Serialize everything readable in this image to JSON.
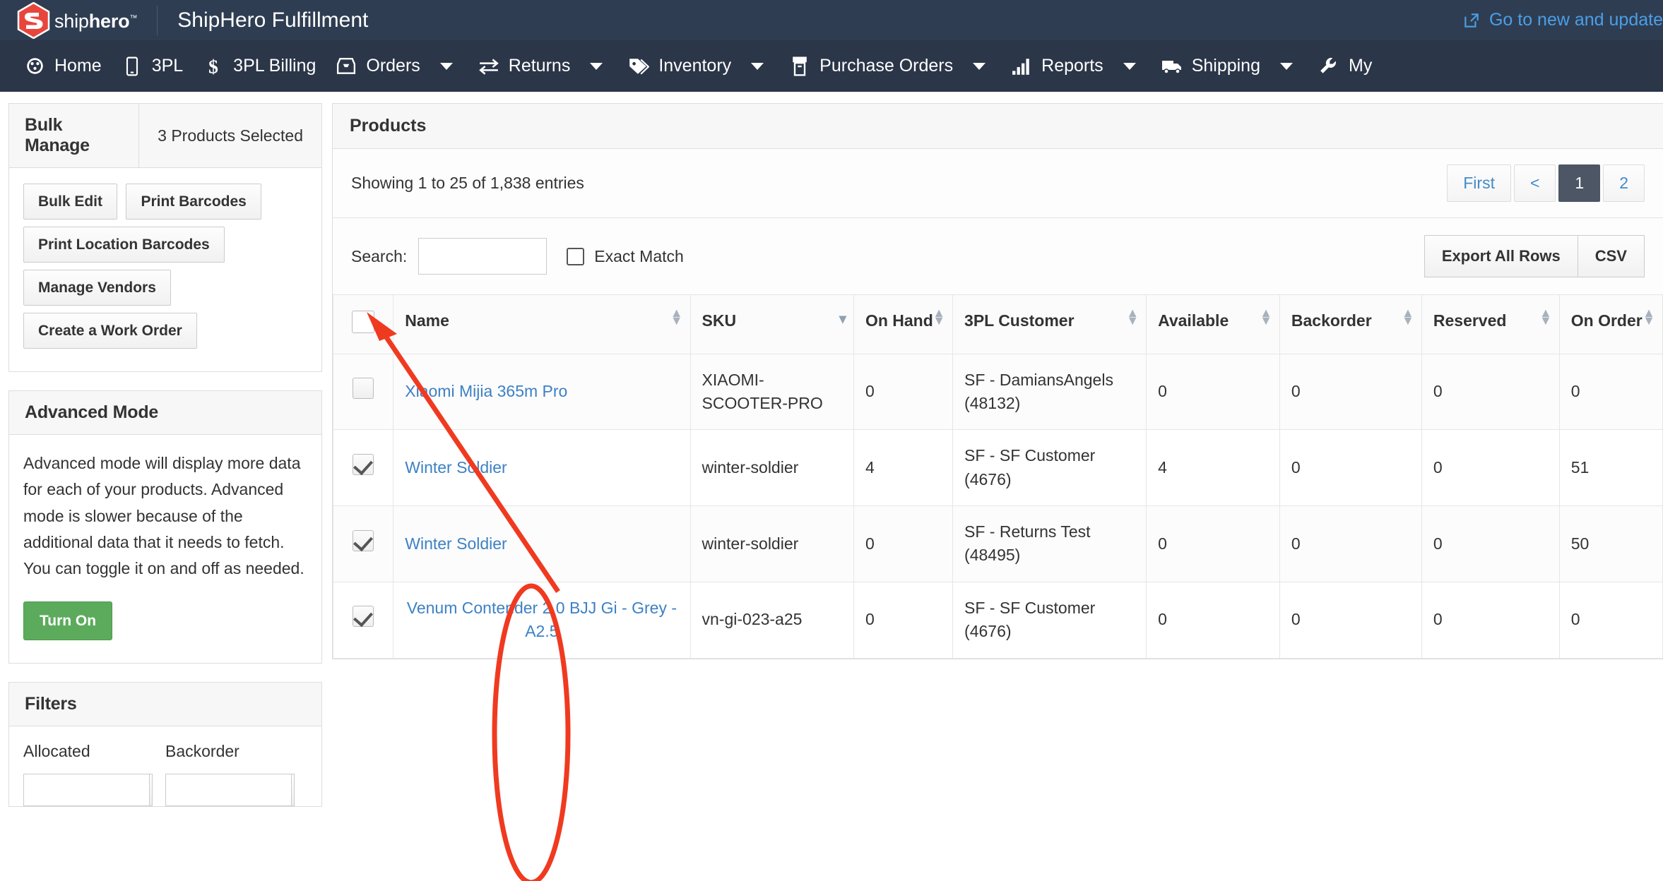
{
  "header": {
    "brand_name_light": "ship",
    "brand_name_bold": "hero",
    "brand_tm": "™",
    "app_title": "ShipHero Fulfillment",
    "new_link": "Go to new and update",
    "colors": {
      "topbar": "#2f3d52",
      "navbar": "#2b3648",
      "brand_red": "#e8463c",
      "link_blue": "#4a9fe8"
    }
  },
  "nav": {
    "items": [
      {
        "label": "Home",
        "icon": "dashboard-icon",
        "has_caret": false
      },
      {
        "label": "3PL",
        "icon": "mobile-icon",
        "has_caret": false
      },
      {
        "label": "3PL Billing",
        "icon": "dollar-icon",
        "has_caret": false
      },
      {
        "label": "Orders",
        "icon": "inbox-icon",
        "has_caret": true
      },
      {
        "label": "Returns",
        "icon": "exchange-icon",
        "has_caret": true
      },
      {
        "label": "Inventory",
        "icon": "tags-icon",
        "has_caret": true
      },
      {
        "label": "Purchase Orders",
        "icon": "archive-icon",
        "has_caret": true
      },
      {
        "label": "Reports",
        "icon": "bar-chart-icon",
        "has_caret": true
      },
      {
        "label": "Shipping",
        "icon": "truck-icon",
        "has_caret": true
      },
      {
        "label": "My",
        "icon": "wrench-icon",
        "has_caret": false
      }
    ]
  },
  "sidebar": {
    "bulk_manage": {
      "title": "Bulk Manage",
      "selected_count": "3 Products Selected",
      "buttons": [
        "Bulk Edit",
        "Print Barcodes",
        "Print Location Barcodes",
        "Manage Vendors",
        "Create a Work Order"
      ]
    },
    "advanced_mode": {
      "title": "Advanced Mode",
      "description": "Advanced mode will display more data for each of your products. Advanced mode is slower because of the additional data that it needs to fetch. You can toggle it on and off as needed.",
      "toggle_label": "Turn On",
      "toggle_color": "#5cab5c"
    },
    "filters": {
      "title": "Filters",
      "fields": [
        {
          "label": "Allocated",
          "value": ""
        },
        {
          "label": "Backorder",
          "value": ""
        }
      ]
    }
  },
  "products": {
    "title": "Products",
    "showing": "Showing 1 to 25 of 1,838 entries",
    "pagination": [
      {
        "label": "First",
        "active": false
      },
      {
        "label": "<",
        "active": false
      },
      {
        "label": "1",
        "active": true
      },
      {
        "label": "2",
        "active": false
      }
    ],
    "search": {
      "label": "Search:",
      "value": "",
      "placeholder": ""
    },
    "exact_match": {
      "label": "Exact Match",
      "checked": false
    },
    "export_buttons": [
      "Export All Rows",
      "CSV"
    ],
    "columns": [
      {
        "label": "",
        "sort": "none",
        "key": "checkbox"
      },
      {
        "label": "Name",
        "sort": "both",
        "key": "name"
      },
      {
        "label": "SKU",
        "sort": "desc",
        "key": "sku"
      },
      {
        "label": "On Hand",
        "sort": "both",
        "key": "on_hand"
      },
      {
        "label": "3PL Customer",
        "sort": "both",
        "key": "customer"
      },
      {
        "label": "Available",
        "sort": "both",
        "key": "available"
      },
      {
        "label": "Backorder",
        "sort": "both",
        "key": "backorder"
      },
      {
        "label": "Reserved",
        "sort": "both",
        "key": "reserved"
      },
      {
        "label": "On Order",
        "sort": "both",
        "key": "on_order"
      }
    ],
    "rows": [
      {
        "checked": false,
        "name": "Xiaomi Mijia 365m Pro",
        "sku": "XIAOMI-SCOOTER-PRO",
        "on_hand": "0",
        "customer": "SF - DamiansAngels (48132)",
        "available": "0",
        "backorder": "0",
        "reserved": "0",
        "on_order": "0"
      },
      {
        "checked": true,
        "name": "Winter Soldier",
        "sku": "winter-soldier",
        "on_hand": "4",
        "customer": "SF - SF Customer (4676)",
        "available": "4",
        "backorder": "0",
        "reserved": "0",
        "on_order": "51"
      },
      {
        "checked": true,
        "name": "Winter Soldier",
        "sku": "winter-soldier",
        "on_hand": "0",
        "customer": "SF - Returns Test (48495)",
        "available": "0",
        "backorder": "0",
        "reserved": "0",
        "on_order": "50"
      },
      {
        "checked": true,
        "name": "Venum Contender 2.0 BJJ Gi - Grey - A2.5",
        "sku": "vn-gi-023-a25",
        "on_hand": "0",
        "customer": "SF - SF Customer (4676)",
        "available": "0",
        "backorder": "0",
        "reserved": "0",
        "on_order": "0"
      }
    ]
  },
  "annotations": {
    "color": "#f03a20",
    "shapes": [
      "ellipse-around-checkboxes",
      "arrow-to-manage-vendors"
    ]
  }
}
